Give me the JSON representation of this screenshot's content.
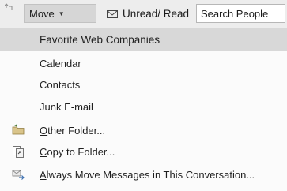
{
  "toolbar": {
    "move_label": "Move",
    "unread_label": "Unread/ Read",
    "search_placeholder": "Search People"
  },
  "menu": {
    "folders": [
      {
        "label": "Favorite Web Companies",
        "highlighted": true
      },
      {
        "label": "Calendar"
      },
      {
        "label": "Contacts"
      },
      {
        "label": "Junk E-mail"
      }
    ],
    "actions": [
      {
        "accel": "O",
        "rest": "ther Folder...",
        "icon": "folder-icon"
      },
      {
        "accel": "C",
        "rest": "opy to Folder...",
        "icon": "copy-folder-icon"
      },
      {
        "accel": "A",
        "rest": "lways Move Messages in This Conversation...",
        "icon": "always-move-icon"
      }
    ]
  },
  "colors": {
    "toolbar_bg": "#ededed",
    "highlight": "#d8d8d8",
    "menu_bg": "#fbfbfb"
  }
}
